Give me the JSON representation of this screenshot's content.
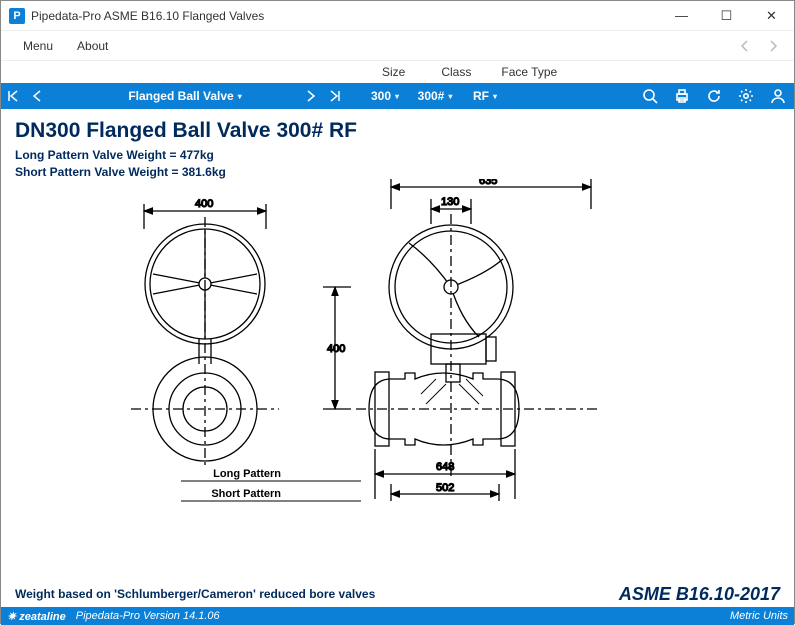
{
  "window": {
    "app_logo_char": "P",
    "title": "Pipedata-Pro  ASME B16.10 Flanged Valves",
    "min": "—",
    "max": "☐",
    "close": "✕"
  },
  "menubar": {
    "menu": "Menu",
    "about": "About"
  },
  "column_labels": {
    "size": "Size",
    "class": "Class",
    "face": "Face Type"
  },
  "toolbar": {
    "selector_main": "Flanged Ball Valve",
    "size": "300",
    "class": "300#",
    "face": "RF"
  },
  "page": {
    "heading": "DN300 Flanged Ball Valve 300# RF",
    "long_weight": "Long Pattern Valve Weight = 477kg",
    "short_weight": "Short Pattern Valve Weight = 381.6kg",
    "footer_left": "Weight based on 'Schlumberger/Cameron' reduced bore valves",
    "footer_right": "ASME B16.10-2017"
  },
  "drawing": {
    "dim_400_top": "400",
    "dim_635": "635",
    "dim_130": "130",
    "dim_400_side": "400",
    "dim_648": "648",
    "dim_502": "502",
    "long_pattern": "Long Pattern",
    "short_pattern": "Short Pattern"
  },
  "status": {
    "brand": "zeataline",
    "version": "Pipedata-Pro Version 14.1.06",
    "units": "Metric Units"
  }
}
